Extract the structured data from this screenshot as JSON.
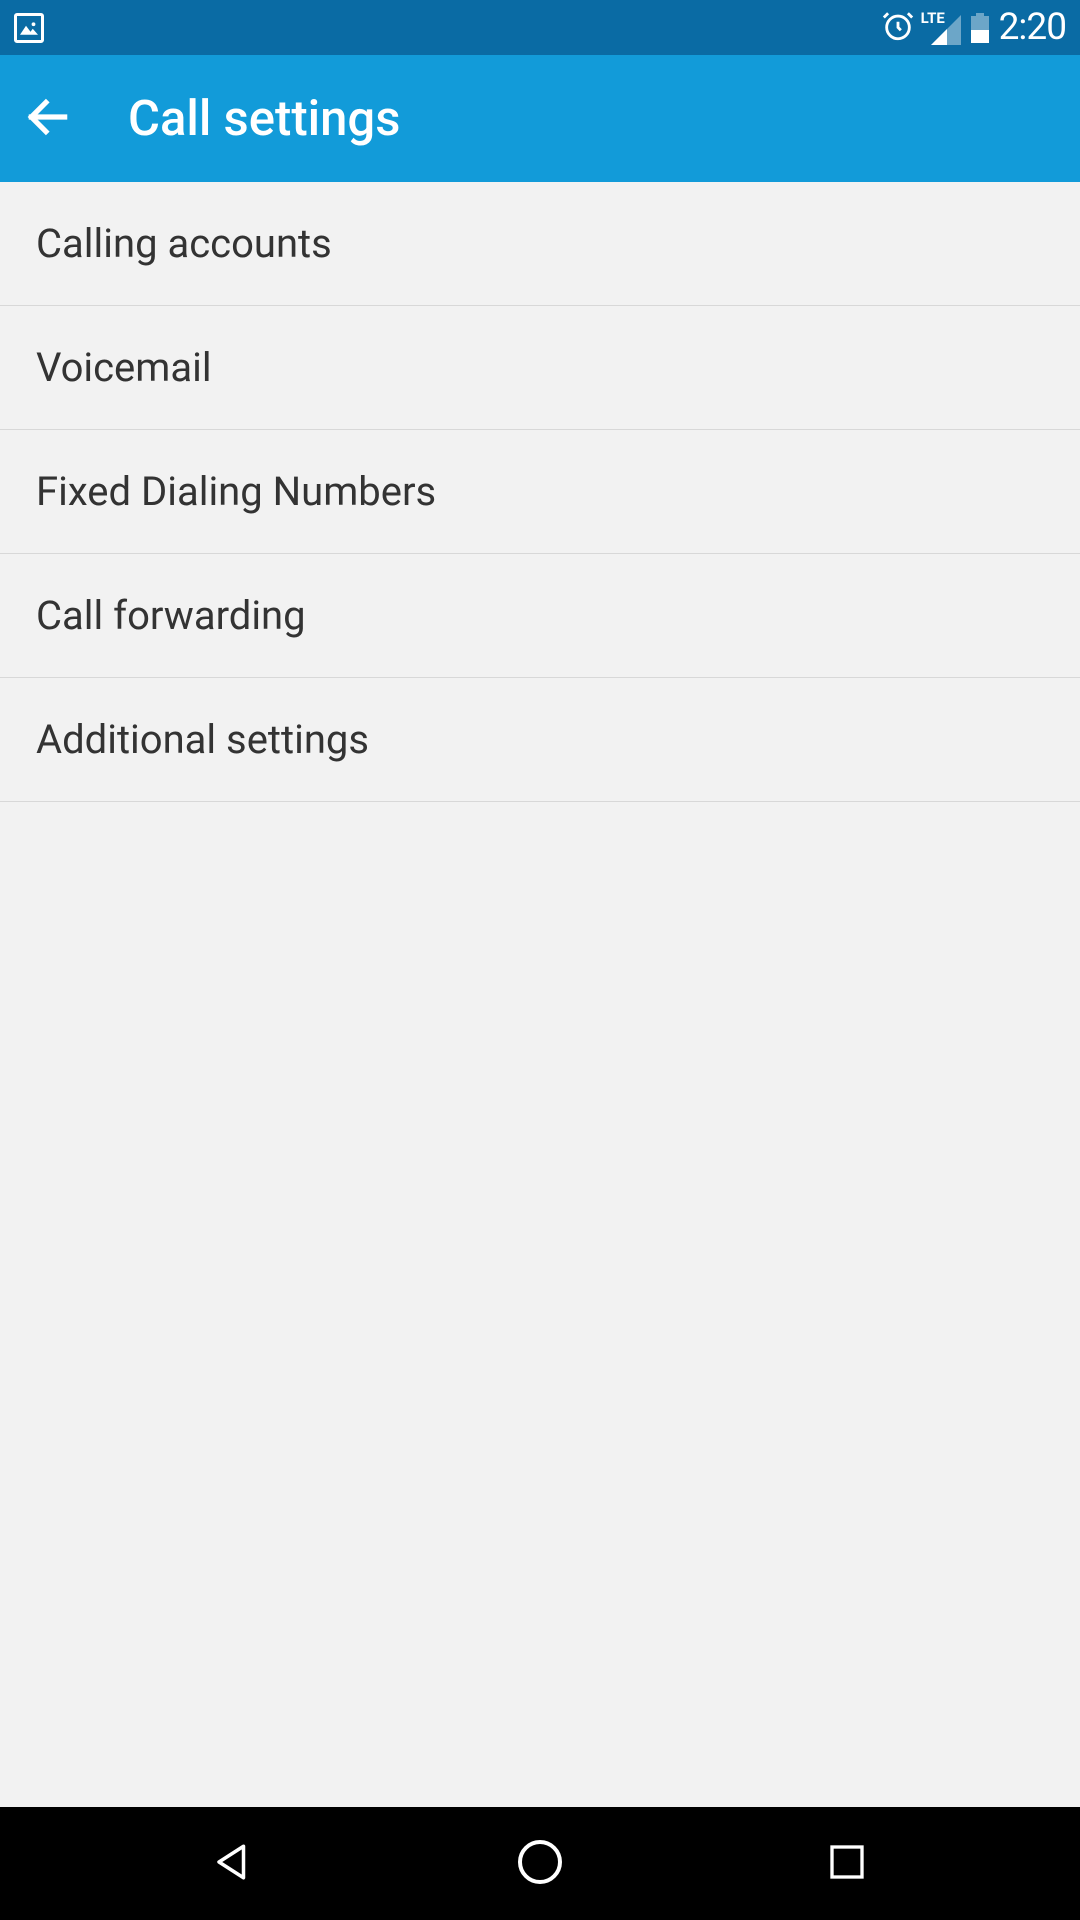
{
  "status_bar": {
    "lte_label": "LTE",
    "time": "2:20"
  },
  "app_bar": {
    "title": "Call settings"
  },
  "settings": {
    "items": [
      {
        "label": "Calling accounts"
      },
      {
        "label": "Voicemail"
      },
      {
        "label": "Fixed Dialing Numbers"
      },
      {
        "label": "Call forwarding"
      },
      {
        "label": "Additional settings"
      }
    ]
  }
}
